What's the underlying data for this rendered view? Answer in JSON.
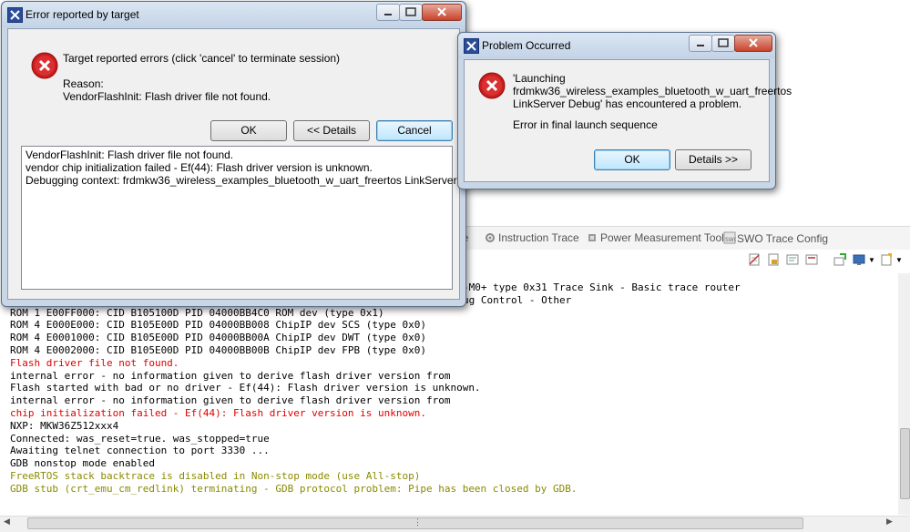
{
  "background": {
    "tabs": [
      {
        "label": "le",
        "icon": "none"
      },
      {
        "label": "Instruction Trace",
        "icon": "gear-icon"
      },
      {
        "label": "Power Measurement Tool",
        "icon": "chip-icon"
      },
      {
        "label": "SWO Trace Config",
        "icon": "swo-icon"
      }
    ],
    "console_lines": [
      {
        "text": "-M0+ type 0x31 Trace Sink - Basic trace router",
        "color": "black",
        "partial": true
      },
      {
        "text": "ug Control - Other",
        "color": "black",
        "partial": true
      },
      {
        "text": "ROM 1 E00FF000: CID B105100D PID 04000BB4C0 ROM dev (type 0x1)",
        "color": "black"
      },
      {
        "text": "ROM 4 E000E000: CID B105E00D PID 04000BB008 ChipIP dev SCS (type 0x0)",
        "color": "black"
      },
      {
        "text": "ROM 4 E0001000: CID B105E00D PID 04000BB00A ChipIP dev DWT (type 0x0)",
        "color": "black"
      },
      {
        "text": "ROM 4 E0002000: CID B105E00D PID 04000BB00B ChipIP dev FPB (type 0x0)",
        "color": "black"
      },
      {
        "text": "Flash driver file not found.",
        "color": "red"
      },
      {
        "text": "internal error - no information given to derive flash driver version from",
        "color": "black"
      },
      {
        "text": "Flash started with bad or no driver - Ef(44): Flash driver version is unknown.",
        "color": "black"
      },
      {
        "text": "internal error - no information given to derive flash driver version from",
        "color": "black"
      },
      {
        "text": "chip initialization failed - Ef(44): Flash driver version is unknown.",
        "color": "red"
      },
      {
        "text": "NXP: MKW36Z512xxx4",
        "color": "black"
      },
      {
        "text": "Connected: was_reset=true. was_stopped=true",
        "color": "black"
      },
      {
        "text": "Awaiting telnet connection to port 3330 ...",
        "color": "black"
      },
      {
        "text": "GDB nonstop mode enabled",
        "color": "black"
      },
      {
        "text": "FreeRTOS stack backtrace is disabled in Non-stop mode (use All-stop)",
        "color": "olive"
      },
      {
        "text": "GDB stub (crt_emu_cm_redlink) terminating - GDB protocol problem: Pipe has been closed by GDB.",
        "color": "olive"
      }
    ],
    "colors": {
      "red": "#e00000",
      "olive": "#8a8a00",
      "black": "#000000"
    }
  },
  "error_dialog": {
    "title": "Error reported by target",
    "message": "Target reported errors (click 'cancel' to terminate session)",
    "reason_label": "Reason:",
    "reason": "VendorFlashInit: Flash driver file not found.",
    "ok_label": "OK",
    "details_label": "<< Details",
    "cancel_label": "Cancel",
    "details_lines": [
      "VendorFlashInit: Flash driver file not found.",
      "vendor chip initialization failed - Ef(44): Flash driver version is unknown.",
      "Debugging context: frdmkw36_wireless_examples_bluetooth_w_uart_freertos LinkServer Debug"
    ]
  },
  "problem_dialog": {
    "title": "Problem Occurred",
    "message_lines": [
      "'Launching",
      "frdmkw36_wireless_examples_bluetooth_w_uart_freertos",
      "LinkServer Debug' has encountered a problem."
    ],
    "detail": "Error in final launch sequence",
    "ok_label": "OK",
    "details_label": "Details >>"
  }
}
